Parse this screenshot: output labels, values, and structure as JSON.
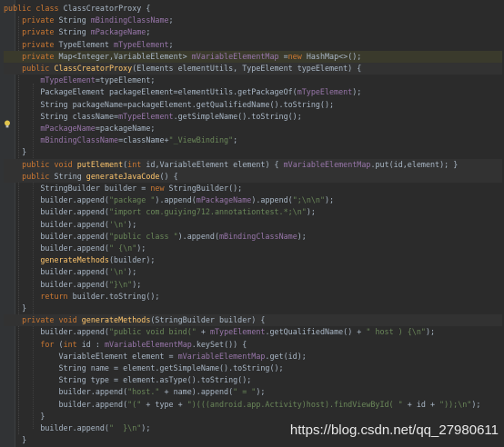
{
  "code": {
    "lines": [
      "public class ClassCreatorProxy {",
      "    private String mBindingClassName;",
      "    private String mPackageName;",
      "    private TypeElement mTypeElement;",
      "    private Map<Integer,VariableElement> mVariableElementMap =new HashMap<>();",
      "    public ClassCreatorProxy(Elements elementUtils, TypeElement typeElement) {",
      "        mTypeElement=typeElement;",
      "        PackageElement packageElement=elementUtils.getPackageOf(mTypeElement);",
      "        String packageName=packageElement.getQualifiedName().toString();",
      "        String className=mTypeElement.getSimpleName().toString();",
      "        mPackageName=packageName;",
      "        mBindingClassName=className+\"_ViewBinding\";",
      "    }",
      "    public void putElement(int id,VariableElement element) { mVariableElementMap.put(id,element); }",
      "    public String generateJavaCode() {",
      "        StringBuilder builder = new StringBuilder();",
      "        builder.append(\"package \").append(mPackageName).append(\";\\n\\n\");",
      "        builder.append(\"import com.guiying712.annotationtest.*;\\n\");",
      "        builder.append('\\n');",
      "        builder.append(\"public class \").append(mBindingClassName);",
      "        builder.append(\" {\\n\");",
      "        generateMethods(builder);",
      "        builder.append('\\n');",
      "        builder.append(\"}\\n\");",
      "        return builder.toString();",
      "    }",
      "    private void generateMethods(StringBuilder builder) {",
      "        builder.append(\"public void bind(\" + mTypeElement.getQualifiedName() + \" host ) {\\n\");",
      "        for (int id : mVariableElementMap.keySet()) {",
      "            VariableElement element = mVariableElementMap.get(id);",
      "            String name = element.getSimpleName().toString();",
      "            String type = element.asType().toString();",
      "            builder.append(\"host.\" + name).append(\" = \");",
      "            builder.append(\"(\" + type + \")(((android.app.Activity)host).findViewById( \" + id + \"));\\n\");",
      "        }",
      "        builder.append(\"  }\\n\");",
      "    }"
    ]
  },
  "watermark": "https://blog.csdn.net/qq_27980611",
  "gutter": {
    "intention_icon": "lightbulb-icon"
  }
}
